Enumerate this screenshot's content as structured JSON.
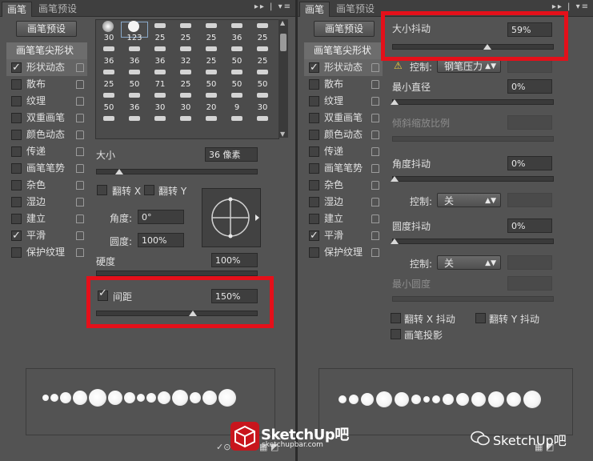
{
  "left": {
    "tabs": [
      "画笔",
      "画笔预设"
    ],
    "preset_button": "画笔预设",
    "sidebar": [
      {
        "label": "画笔笔尖形状",
        "checked": null
      },
      {
        "label": "形状动态",
        "checked": true
      },
      {
        "label": "散布",
        "checked": false
      },
      {
        "label": "纹理",
        "checked": false
      },
      {
        "label": "双重画笔",
        "checked": false
      },
      {
        "label": "颜色动态",
        "checked": false
      },
      {
        "label": "传递",
        "checked": false
      },
      {
        "label": "画笔笔势",
        "checked": false
      },
      {
        "label": "杂色",
        "checked": false
      },
      {
        "label": "湿边",
        "checked": false
      },
      {
        "label": "建立",
        "checked": false
      },
      {
        "label": "平滑",
        "checked": true
      },
      {
        "label": "保护纹理",
        "checked": false
      }
    ],
    "brush_sizes": [
      "30",
      "123",
      "25",
      "25",
      "25",
      "36",
      "25",
      "36",
      "36",
      "36",
      "32",
      "25",
      "50",
      "25",
      "25",
      "50",
      "71",
      "25",
      "50",
      "50",
      "50",
      "50",
      "36",
      "30",
      "30",
      "20",
      "9",
      "30",
      "",
      "",
      "",
      "",
      "",
      "",
      ""
    ],
    "size_label": "大小",
    "size_value": "36 像素",
    "flip_x": "翻转 X",
    "flip_y": "翻转 Y",
    "angle_label": "角度:",
    "angle_value": "0°",
    "roundness_label": "圆度:",
    "roundness_value": "100%",
    "hardness_label": "硬度",
    "hardness_value": "100%",
    "spacing_label": "间距",
    "spacing_value": "150%",
    "spacing_checked": true
  },
  "right": {
    "tabs": [
      "画笔",
      "画笔预设"
    ],
    "preset_button": "画笔预设",
    "sidebar": [
      {
        "label": "画笔笔尖形状",
        "checked": null
      },
      {
        "label": "形状动态",
        "checked": true
      },
      {
        "label": "散布",
        "checked": false
      },
      {
        "label": "纹理",
        "checked": false
      },
      {
        "label": "双重画笔",
        "checked": false
      },
      {
        "label": "颜色动态",
        "checked": false
      },
      {
        "label": "传递",
        "checked": false
      },
      {
        "label": "画笔笔势",
        "checked": false
      },
      {
        "label": "杂色",
        "checked": false
      },
      {
        "label": "湿边",
        "checked": false
      },
      {
        "label": "建立",
        "checked": false
      },
      {
        "label": "平滑",
        "checked": true
      },
      {
        "label": "保护纹理",
        "checked": false
      }
    ],
    "size_jitter_label": "大小抖动",
    "size_jitter_value": "59%",
    "control_label": "控制:",
    "control_value": "钢笔压力",
    "min_diameter_label": "最小直径",
    "min_diameter_value": "0%",
    "tilt_scale_label": "倾斜缩放比例",
    "angle_jitter_label": "角度抖动",
    "angle_jitter_value": "0%",
    "angle_control_label": "控制:",
    "angle_control_value": "关",
    "roundness_jitter_label": "圆度抖动",
    "roundness_jitter_value": "0%",
    "roundness_control_label": "控制:",
    "roundness_control_value": "关",
    "min_roundness_label": "最小圆度",
    "flip_x_jitter": "翻转 X 抖动",
    "flip_y_jitter": "翻转 Y 抖动",
    "brush_projection": "画笔投影"
  },
  "watermarks": {
    "logo_main": "SketchUp吧",
    "logo_url": "sketchupbar.com",
    "wechat": "SketchUp吧"
  },
  "colors": {
    "highlight": "#e4101a"
  },
  "sliders": {
    "left_size": 0.14,
    "left_spacing": 0.6,
    "right_size_jitter": 0.59
  },
  "left_stroke_dot_diameters": [
    8,
    10,
    14,
    18,
    22,
    18,
    14,
    10,
    12,
    16,
    20,
    14,
    18,
    22
  ],
  "right_stroke_dot_diameters": [
    10,
    12,
    16,
    20,
    18,
    12,
    8,
    10,
    14,
    16,
    18,
    20,
    18,
    22
  ]
}
